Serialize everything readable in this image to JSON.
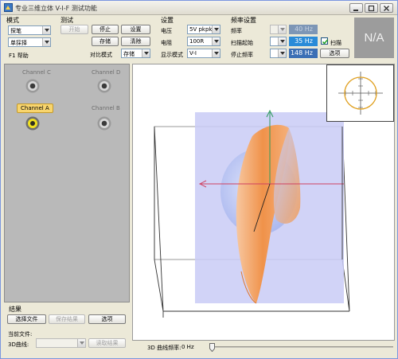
{
  "window": {
    "title": "专业三维立体 V-I-F 测试功能"
  },
  "mode": {
    "heading": "模式",
    "probe_value": "探笔",
    "step_value": "单採择",
    "f1_label": "F1 帮助"
  },
  "test": {
    "heading": "测试",
    "start_label": "开始",
    "stop_label": "停止",
    "settings_label": "设置",
    "store_label": "存储",
    "clear_label": "清除",
    "compare_mode_label": "对比模式",
    "compare_mode_value": "存储"
  },
  "settings": {
    "heading": "设置",
    "voltage_label": "电压",
    "voltage_value": "5V pkpk",
    "resistance_label": "电阻",
    "resistance_value": "100R",
    "display_mode_label": "显示模式",
    "display_mode_value": "V-I"
  },
  "frequency": {
    "heading": "频率设置",
    "freq_label": "频率",
    "freq_value": "40 Hz",
    "start_label": "扫描起始",
    "start_value": "35 Hz",
    "stop_label": "停止频率",
    "stop_value": "148 Hz",
    "sweep_label": "扫描",
    "sweep_checked": true,
    "options_label": "选项"
  },
  "status_box": {
    "text": "N/A"
  },
  "channels": [
    {
      "name": "Channel C",
      "active": false
    },
    {
      "name": "Channel D",
      "active": false
    },
    {
      "name": "Channel A",
      "active": true
    },
    {
      "name": "Channel B",
      "active": false
    }
  ],
  "results": {
    "heading": "结果",
    "select_file_label": "选择文件",
    "save_results_label": "保存结果",
    "options_label": "选项",
    "current_file_label": "当前文件:",
    "curve_label": "3D曲线:",
    "read_results_label": "读取结果"
  },
  "plot3d": {
    "freq_readout_label": "3D 曲线频率:",
    "freq_readout_value": "0 Hz"
  },
  "colors": {
    "accent_blue": "#3b6fb5",
    "active_channel": "#f8d56e",
    "surface_orange": "#f0a060",
    "plane_fill": "#c9cbf6",
    "axis_green": "#2a9a5a",
    "axis_red": "#d04060"
  }
}
